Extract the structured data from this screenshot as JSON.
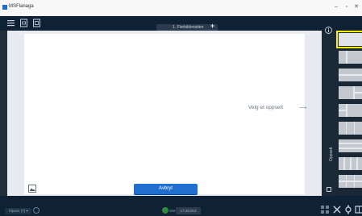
{
  "window": {
    "app_title": "MSFlanaga",
    "minimize": "–",
    "maximize": "▫",
    "close": "✕"
  },
  "toolbar": {
    "icons": [
      "menu-icon",
      "document-icon",
      "document-copy-icon"
    ],
    "page_tab_label": "1. Flerbildersiden",
    "add_page": "+"
  },
  "canvas": {
    "empty_hint": "Velg et oppsett",
    "hint_arrow": "⟶",
    "apply_label": "Avbryt"
  },
  "side_panel": {
    "tab_label": "Oppsett",
    "layouts": [
      {
        "name": "single",
        "selected": true
      },
      {
        "name": "two-columns-narrow",
        "selected": false
      },
      {
        "name": "two-rows",
        "selected": false
      },
      {
        "name": "main-plus-right-column",
        "selected": false
      },
      {
        "name": "left-main-plus-column",
        "selected": false
      },
      {
        "name": "three-columns",
        "selected": false
      },
      {
        "name": "stacked-rows",
        "selected": false
      },
      {
        "name": "four-columns",
        "selected": false
      },
      {
        "name": "grid",
        "selected": false
      }
    ],
    "highlight_color": "#ffee00"
  },
  "statusbar": {
    "zoom_label": "Tilpass (7) ▾",
    "status_text": "Sist",
    "status_value": "17:25:013",
    "icons": [
      "grid-icon",
      "tools-icon",
      "settings-icon",
      "layout-icon"
    ]
  },
  "colors": {
    "accent": "#1f6fd1",
    "toolbar": "#0f2235",
    "workspace": "#212f3d"
  }
}
